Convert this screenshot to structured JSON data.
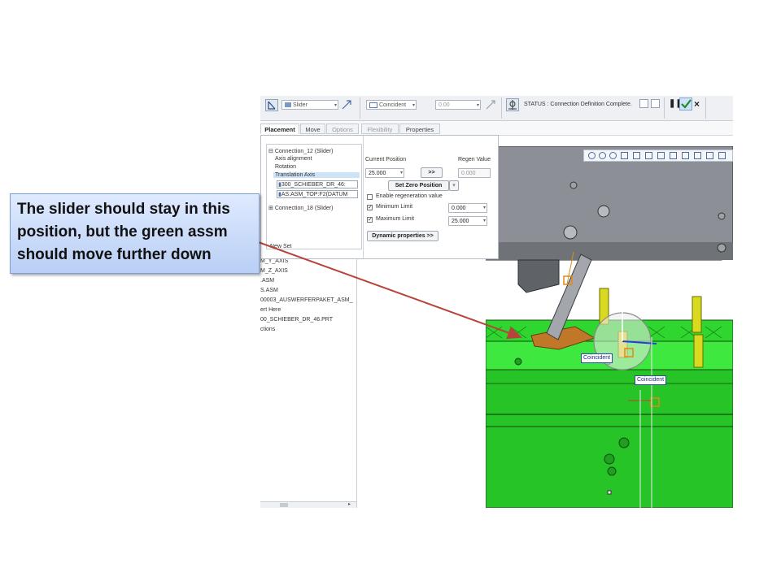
{
  "slide": {
    "callout_lines": [
      "The slider should stay in this",
      "position, but the green assm",
      "should move further down"
    ]
  },
  "ribbon": {
    "connection_type": "Slider",
    "constraint_type": "Coincident",
    "offset_value": "0.00",
    "status_text": "STATUS : Connection Definition Complete."
  },
  "tabs": [
    "Placement",
    "Move",
    "Options",
    "Flexibility",
    "Properties"
  ],
  "placement": {
    "tree": {
      "connection_12": "Connection_12 (Slider)",
      "axis_alignment": "Axis alignment",
      "rotation": "Rotation",
      "translation_axis": "Translation Axis",
      "ref_1": "300_SCHIEBER_DR_46:",
      "ref_2": "AS:ASM_TOP:F2(DATUM",
      "connection_18": "Connection_18 (Slider)",
      "new_set": "New Set"
    },
    "current_position_label": "Current Position",
    "current_position_value": "25.000",
    "go_button": ">>",
    "regen_value_label": "Regen Value",
    "regen_value": "0.000",
    "set_zero_button": "Set Zero Position",
    "enable_regen_label": "Enable regeneration value",
    "enable_regen_checked": false,
    "min_limit_label": "Minimum Limit",
    "min_limit_checked": true,
    "min_limit_value": "0.000",
    "max_limit_label": "Maximum Limit",
    "max_limit_checked": true,
    "max_limit_value": "25.000",
    "dynamic_props_button": "Dynamic properties >>"
  },
  "model_tree": [
    "M_Y_AXIS",
    "M_Z_AXIS",
    ".ASM",
    "S.ASM",
    "00003_AUSWERFERPAKET_ASM_",
    "ert Here",
    "00_SCHIEBER_DR_46.PRT",
    "ctions"
  ],
  "viewport": {
    "label_1": "Coincident",
    "label_2": "Coincident"
  },
  "colors": {
    "green_assembly": "#2fd62f",
    "grey_plate": "#8c9096",
    "callout_fill": "#c9dbfa",
    "arrow": "#b8433a"
  }
}
